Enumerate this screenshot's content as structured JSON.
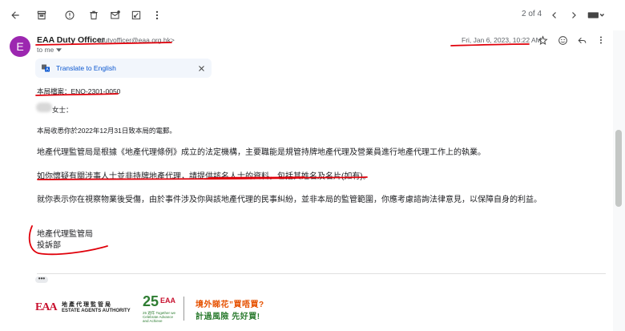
{
  "toolbar": {
    "pager": "2 of 4",
    "icons": [
      "back-arrow-icon",
      "archive-icon",
      "report-spam-icon",
      "delete-icon",
      "mark-unread-icon",
      "snooze-icon",
      "more-vert-icon",
      "chevron-left-icon",
      "chevron-right-icon",
      "keyboard-icon"
    ]
  },
  "message": {
    "avatar_letter": "E",
    "avatar_color": "#9c27b0",
    "sender_name": "EAA Duty Officer",
    "sender_email": "<dutyofficer@eaa.org.hk>",
    "to": "to me",
    "date": "Fri, Jan 6, 2023, 10:22 AM"
  },
  "translate": {
    "label": "Translate to English"
  },
  "body": {
    "ref": "本局檔案：ENQ-2301-0050",
    "salutation": "女士：",
    "received": "本局收悉你於2022年12月31日致本局的電郵。",
    "para1": "地產代理監管局是根據《地產代理條例》成立的法定機構，主要職能是規管持牌地產代理及營業員進行地產代理工作上的執業。",
    "para2": "如你懷疑有關涉事人士並非持牌地產代理，請提供該名人士的資料，包括其姓名及名片(如有)。",
    "para3": "就你表示你在視察物業後受傷，由於事件涉及你與該地產代理的民事糾紛，並非本局的監管範圍，你應考慮諮詢法律意見，以保障自身的利益。",
    "sig1": "地產代理監管局",
    "sig2": "投訴部"
  },
  "footer": {
    "eaa_mark": "EAA",
    "eaa_cn": "地產代理監管局",
    "eaa_en": "ESTATE AGENTS AUTHORITY",
    "anniv_num": "25",
    "anniv_eaa": "EAA",
    "anniv_sub": "25 週年 Together we Celebrate Advance and Achieve",
    "slogan1": "境外睇花”買唔買?",
    "slogan2": "計過風險 先好買!"
  },
  "colors": {
    "accent": "#0b57d0",
    "annotation": "#e0000a",
    "brand_red": "#c8102e",
    "brand_green": "#2e7d32"
  }
}
